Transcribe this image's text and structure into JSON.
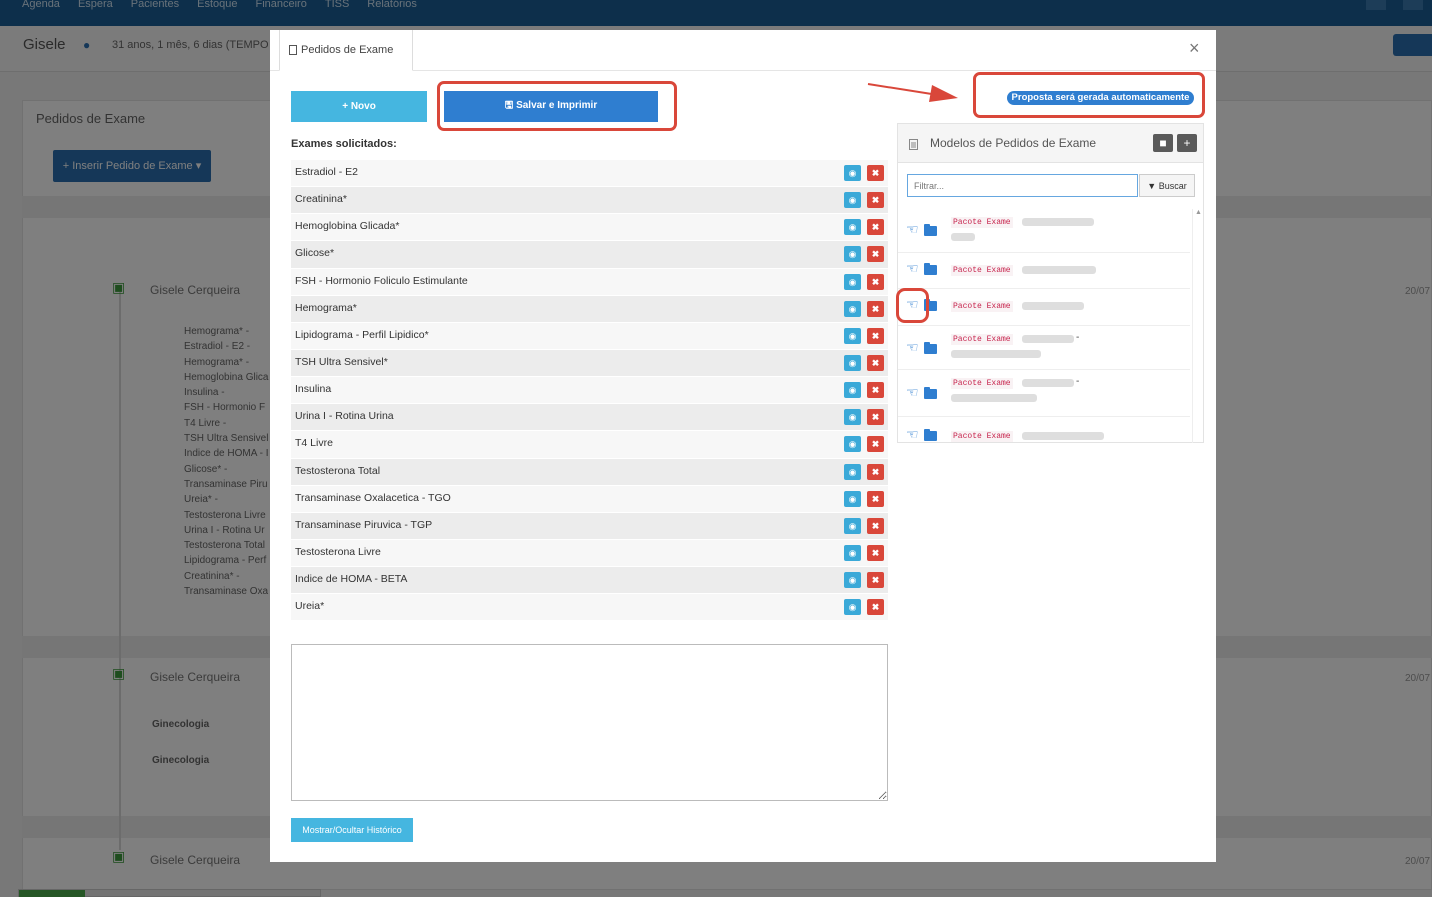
{
  "topnav": {
    "items": [
      "Agenda",
      "Espera",
      "Pacientes",
      "Estoque",
      "Financeiro",
      "TISS",
      "Relatórios"
    ]
  },
  "patient": {
    "name": "Gisele",
    "age_info": "31 anos, 1 mês, 6 dias (TEMPO"
  },
  "bg": {
    "panel_title": "Pedidos de Exame",
    "insert_button": "Inserir Pedido de Exame",
    "timeline": [
      {
        "title": "Gisele Cerqueira",
        "date": "20/07"
      },
      {
        "title": "Gisele Cerqueira",
        "date": "20/07"
      },
      {
        "title": "Gisele Cerqueira",
        "date": "20/07"
      }
    ],
    "list": [
      "Hemograma* -",
      "Estradiol - E2 -",
      "Hemograma* -",
      "Hemoglobina Glica",
      "Insulina -",
      "FSH - Hormonio F",
      "T4 Livre -",
      "TSH Ultra Sensivel",
      "Indice de HOMA - I",
      "Glicose* -",
      "Transaminase Piru",
      "Ureia* -",
      "Testosterona Livre",
      "Urina I - Rotina Ur",
      "Testosterona Total",
      "Lipidograma - Perf",
      "Creatinina* -",
      "Transaminase Oxa"
    ],
    "sub_labels": [
      "Ginecologia",
      "Ginecologia"
    ]
  },
  "modal": {
    "tab_title": "Pedidos de Exame",
    "close": "×",
    "novo_label": "Novo",
    "salvar_label": "Salvar e Imprimir",
    "exams_label": "Exames solicitados:",
    "exams": [
      "Estradiol - E2",
      "Creatinina*",
      "Hemoglobina Glicada*",
      "Glicose*",
      "FSH - Hormonio Foliculo Estimulante",
      "Hemograma*",
      "Lipidograma - Perfil Lipidico*",
      "TSH Ultra Sensivel*",
      "Insulina",
      "Urina I - Rotina Urina",
      "T4 Livre",
      "Testosterona Total",
      "Transaminase Oxalacetica - TGO",
      "Transaminase Piruvica - TGP",
      "Testosterona Livre",
      "Indice de HOMA - BETA",
      "Ureia*"
    ],
    "history_button": "Mostrar/Ocultar Histórico",
    "proposta_badge": "Proposta será gerada automaticamente",
    "models": {
      "title": "Modelos de Pedidos de Exame",
      "filter_placeholder": "Filtrar...",
      "buscar_label": "Buscar",
      "items": [
        {
          "tag": "Pacote Exame"
        },
        {
          "tag": "Pacote Exame"
        },
        {
          "tag": "Pacote Exame"
        },
        {
          "tag": "Pacote Exame",
          "visible_suffix": "-"
        },
        {
          "tag": "Pacote Exame",
          "visible_suffix": "-"
        },
        {
          "tag": "Pacote Exame"
        }
      ]
    }
  },
  "colors": {
    "primary": "#2f7ed0",
    "info": "#45b6e0",
    "danger": "#d9473a",
    "nav": "#1b5f96"
  }
}
